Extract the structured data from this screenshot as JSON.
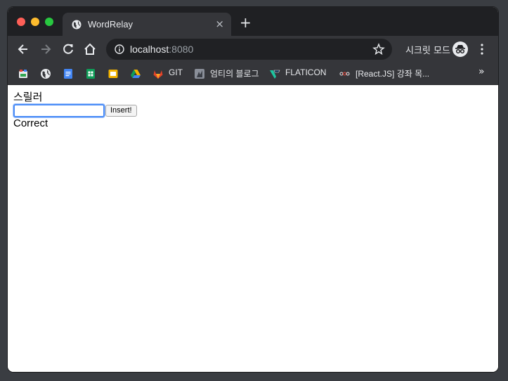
{
  "tab": {
    "title": "WordRelay",
    "close_glyph": "×",
    "new_tab_glyph": "+"
  },
  "omnibox": {
    "host": "localhost",
    "port": ":8080"
  },
  "profile": {
    "label": "시크릿 모드"
  },
  "bookmarks": {
    "items": [
      {
        "label": "GIT",
        "icon": "gitlab-icon"
      },
      {
        "label": "엄티의 블로그",
        "icon": "blog-avatar-icon"
      },
      {
        "label": "FLATICON",
        "icon": "flaticon-icon"
      },
      {
        "label": "[React.JS] 강좌 목...",
        "icon": "react-course-icon"
      }
    ],
    "overflow": "»"
  },
  "game": {
    "word": "스릴러",
    "input_value": "",
    "button_label": "Insert!",
    "result": "Correct"
  },
  "colors": {
    "accent_focus": "#4a8cf7",
    "titlebar": "#1f2023",
    "toolbar": "#35363a"
  }
}
